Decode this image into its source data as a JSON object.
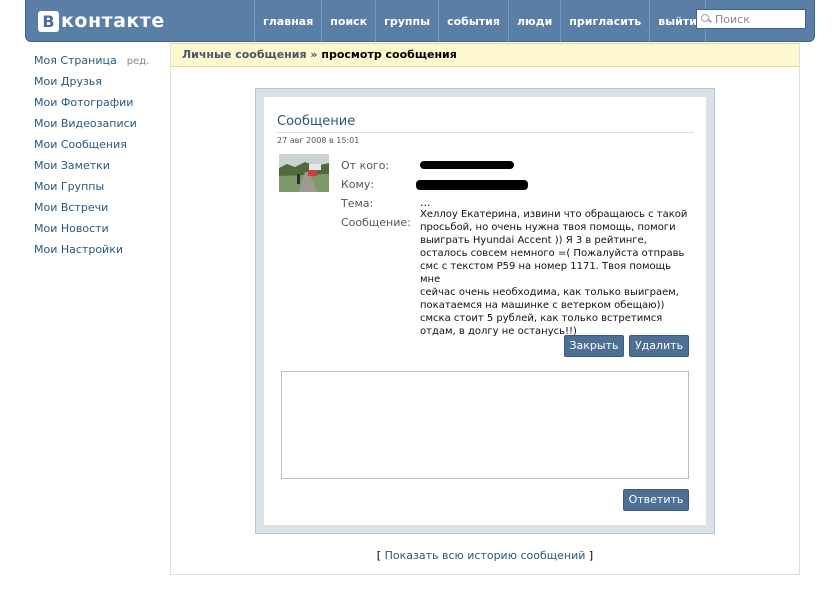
{
  "header": {
    "logo_letter": "В",
    "logo_text": "контакте",
    "nav": [
      "главная",
      "поиск",
      "группы",
      "события",
      "люди",
      "пригласить",
      "выйти"
    ],
    "search_placeholder": "Поиск"
  },
  "sidebar": {
    "items": [
      "Моя Страница",
      "Мои Друзья",
      "Мои Фотографии",
      "Мои Видеозаписи",
      "Мои Сообщения",
      "Мои Заметки",
      "Мои Группы",
      "Мои Встречи",
      "Мои Новости",
      "Мои Настройки"
    ],
    "edit_label": "ред."
  },
  "breadcrumb": {
    "link": "Личные сообщения",
    "separator": "»",
    "current": "просмотр сообщения"
  },
  "message": {
    "title": "Сообщение",
    "date": "27 авг 2008 в 15:01",
    "from_label": "От кого:",
    "to_label": "Кому:",
    "subject_label": "Тема:",
    "subject_value": "...",
    "body_label": "Сообщение:",
    "body_lines": [
      "Хеллоу Екатерина, извини что обращаюсь с такой",
      "просьбой, но очень нужна твоя помощь, помоги",
      "выиграть Hyundai Accent )) Я 3 в рейтинге,",
      "осталось совсем немного =( Пожалуйста отправь",
      "смс с текстом P59 на номер 1171. Твоя помощь мне",
      "сейчас очень необходима, как только выиграем,",
      "покатаемся на машинке с ветерком обещаю))",
      "смска стоит 5 рублей, как только встретимся",
      "отдам, в долгу не останусь!!)"
    ],
    "close_button": "Закрыть",
    "delete_button": "Удалить",
    "reply_button": "Ответить"
  },
  "footer": {
    "bracket_open": "[",
    "history_link": "Показать всю историю сообщений",
    "bracket_close": "]"
  },
  "colors": {
    "header_bg": "#5b7ea6",
    "link": "#2b587a",
    "button_bg": "#4d6f93",
    "breadcrumb_bg": "#fef8cf"
  }
}
